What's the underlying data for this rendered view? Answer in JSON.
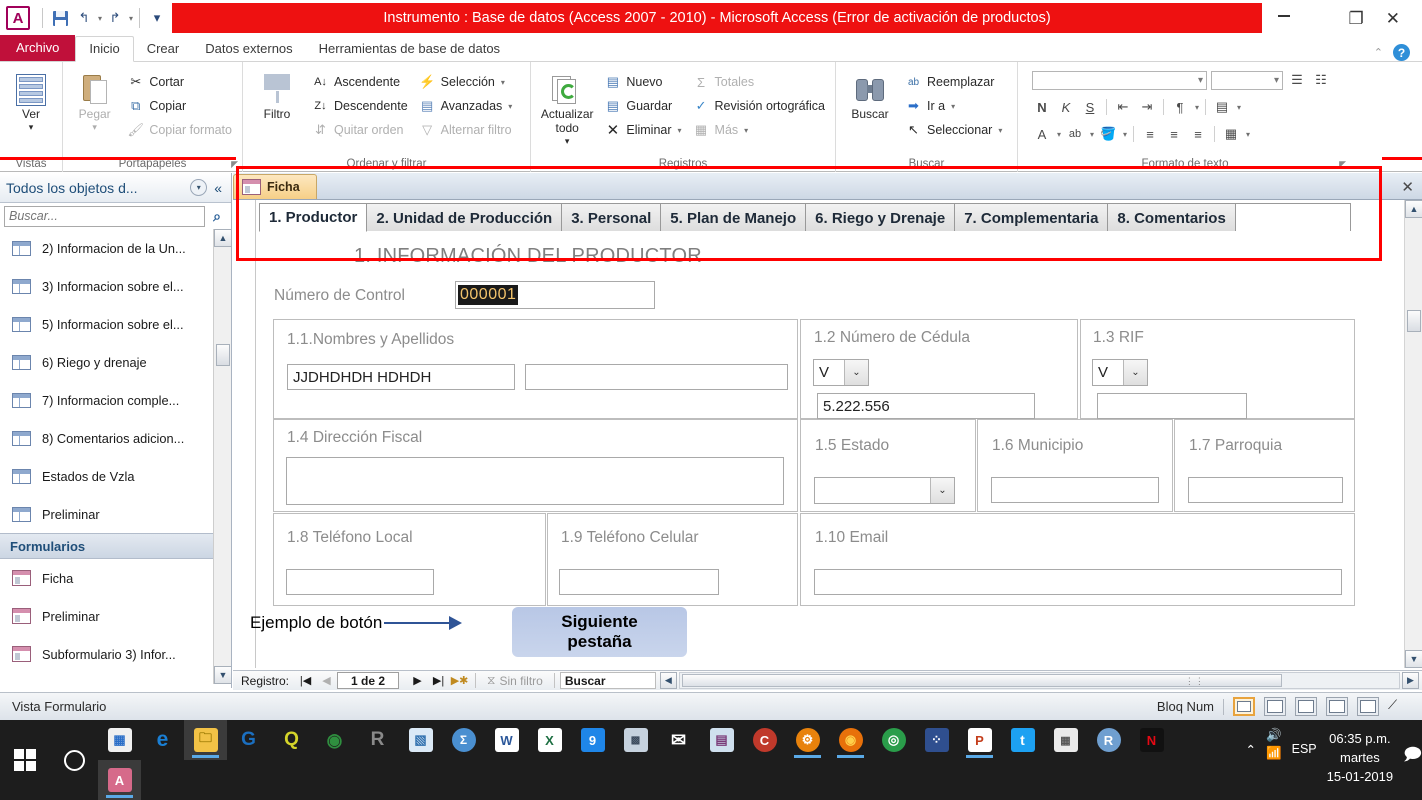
{
  "titlebar": {
    "app_initial": "A",
    "title": "Instrumento : Base de datos (Access 2007 - 2010)  -  Microsoft Access (Error de activación de productos)",
    "qat": [
      {
        "name": "save",
        "glyph": "save"
      },
      {
        "name": "undo",
        "glyph": "↰"
      },
      {
        "name": "redo",
        "glyph": "↱"
      },
      {
        "name": "customize",
        "glyph": "▾"
      }
    ],
    "window_buttons": {
      "minimize": "—",
      "restore": "❐",
      "close": "✕"
    }
  },
  "ribbon_tabs": {
    "file": "Archivo",
    "tabs": [
      "Inicio",
      "Crear",
      "Datos externos",
      "Herramientas de base de datos"
    ],
    "active": "Inicio",
    "collapse_glyph": "⌃",
    "help_glyph": "?"
  },
  "ribbon": {
    "groups": [
      {
        "name": "Vistas",
        "title": "Vistas",
        "big": [
          {
            "label": "Ver",
            "caret": "▾",
            "icon": "view-datasheet-icon"
          }
        ],
        "small": []
      },
      {
        "name": "Portapapeles",
        "title": "Portapapeles",
        "big": [
          {
            "label": "Pegar",
            "caret": "▾",
            "icon": "paste-icon",
            "disabled": true
          }
        ],
        "small": [
          {
            "label": "Cortar",
            "icon": "scissors-icon",
            "glyph": "✂",
            "disabled": false
          },
          {
            "label": "Copiar",
            "icon": "copy-icon",
            "glyph": "⧉",
            "disabled": false
          },
          {
            "label": "Copiar formato",
            "icon": "format-painter-icon",
            "glyph": "🖌",
            "disabled": true
          }
        ],
        "launcher": true
      },
      {
        "name": "Ordenar y filtrar",
        "title": "Ordenar y filtrar",
        "big": [
          {
            "label": "Filtro",
            "caret": "",
            "icon": "funnel-icon"
          }
        ],
        "small": [
          {
            "label": "Ascendente",
            "icon": "sort-ascending-icon",
            "glyph": "A↓",
            "disabled": false
          },
          {
            "label": "Descendente",
            "icon": "sort-descending-icon",
            "glyph": "Z↓",
            "disabled": false
          },
          {
            "label": "Quitar orden",
            "icon": "clear-sort-icon",
            "glyph": "⇵",
            "disabled": true
          },
          {
            "label": "Selección",
            "icon": "selection-icon",
            "glyph": "⚡",
            "caret": "▾",
            "disabled": false
          },
          {
            "label": "Avanzadas",
            "icon": "advanced-filter-icon",
            "glyph": "▤",
            "caret": "▾",
            "disabled": false
          },
          {
            "label": "Alternar filtro",
            "icon": "toggle-filter-icon",
            "glyph": "▽",
            "disabled": true
          }
        ]
      },
      {
        "name": "Registros",
        "title": "Registros",
        "big": [
          {
            "label": "Actualizar todo",
            "caret": "▾",
            "icon": "refresh-all-icon"
          }
        ],
        "small": [
          {
            "label": "Nuevo",
            "icon": "new-record-icon",
            "glyph": "▤",
            "disabled": false
          },
          {
            "label": "Guardar",
            "icon": "save-record-icon",
            "glyph": "▤",
            "disabled": false
          },
          {
            "label": "Eliminar",
            "icon": "delete-record-icon",
            "glyph": "✕",
            "caret": "▾",
            "disabled": false
          },
          {
            "label": "Totales",
            "icon": "totals-icon",
            "glyph": "Σ",
            "disabled": true
          },
          {
            "label": "Revisión ortográfica",
            "icon": "spelling-icon",
            "glyph": "✓",
            "disabled": false
          },
          {
            "label": "Más",
            "icon": "more-icon",
            "glyph": "▦",
            "caret": "▾",
            "disabled": true
          }
        ]
      },
      {
        "name": "Buscar",
        "title": "Buscar",
        "big": [
          {
            "label": "Buscar",
            "caret": "",
            "icon": "binoculars-icon"
          }
        ],
        "small": [
          {
            "label": "Reemplazar",
            "icon": "replace-icon",
            "glyph": "ab",
            "disabled": false
          },
          {
            "label": "Ir a",
            "icon": "goto-icon",
            "glyph": "➡",
            "caret": "▾",
            "disabled": false
          },
          {
            "label": "Seleccionar",
            "icon": "select-icon",
            "glyph": "↖",
            "caret": "▾",
            "disabled": false
          }
        ]
      },
      {
        "name": "Formato de texto",
        "title": "Formato de texto",
        "big": [],
        "small": [],
        "font_controls": {
          "font_name": "",
          "font_size": "",
          "bold": "N",
          "italic": "K",
          "underline": "S",
          "bullets_icon": "bullet-list-icon",
          "numbering_icon": "numbered-list-icon",
          "outdent_icon": "decrease-indent-icon",
          "indent_icon": "increase-indent-icon",
          "ltr_icon": "text-direction-icon",
          "grid_icon": "gridlines-icon",
          "font_color": "A",
          "highlight": "ab",
          "fill_color": "fill-color-icon",
          "align_left_icon": "align-left-icon",
          "align_center_icon": "align-center-icon",
          "align_right_icon": "align-right-icon",
          "alt_fill_icon": "alternate-row-color-icon"
        },
        "launcher": true
      }
    ]
  },
  "navpane": {
    "title": "Todos los objetos d...",
    "dropdown_glyph": "▾",
    "collapse_glyph": "«",
    "search_placeholder": "Buscar...",
    "search_value": "",
    "search_icon": "search-icon",
    "tables": [
      "2) Informacion de la Un...",
      "3) Informacion sobre el...",
      "5) Informacion sobre el...",
      "6) Riego y drenaje",
      "7) Informacion comple...",
      "8) Comentarios adicion...",
      "Estados de Vzla",
      "Preliminar"
    ],
    "group_header": "Formularios",
    "group_chevron": "⌃",
    "forms": [
      "Ficha",
      "Preliminar",
      "Subformulario 3) Infor..."
    ],
    "scroll_up_glyph": "▲",
    "scroll_down_glyph": "▼"
  },
  "document": {
    "tab_label": "Ficha",
    "tab_icon": "form-icon",
    "close_glyph": "✕"
  },
  "form": {
    "tabs": [
      "1. Productor",
      "2. Unidad de Producción",
      "3. Personal",
      "5. Plan de Manejo",
      "6. Riego y Drenaje",
      "7. Complementaria",
      "8. Comentarios"
    ],
    "active_tab": "1. Productor",
    "heading": "1. INFORMACIÓN DEL PRODUCTOR",
    "control_number": {
      "label": "Número de Control",
      "value": "000001",
      "selected": true
    },
    "fields": {
      "names": {
        "label": "1.1.Nombres y Apellidos",
        "value_first": "JJDHDHDH HDHDH",
        "value_second": ""
      },
      "cedula": {
        "label": "1.2 Número de Cédula",
        "prefix": "V",
        "value": "5.222.556"
      },
      "rif": {
        "label": "1.3 RIF",
        "prefix": "V",
        "value": ""
      },
      "direccion": {
        "label": "1.4 Dirección Fiscal",
        "value": ""
      },
      "estado": {
        "label": "1.5 Estado",
        "value": ""
      },
      "municipio": {
        "label": "1.6 Municipio",
        "value": ""
      },
      "parroquia": {
        "label": "1.7 Parroquia",
        "value": ""
      },
      "telefono_local": {
        "label": "1.8 Teléfono Local",
        "value": ""
      },
      "telefono_celular": {
        "label": "1.9 Teléfono Celular",
        "value": ""
      },
      "email": {
        "label": "1.10 Email",
        "value": ""
      }
    },
    "annotation": {
      "label": "Ejemplo de botón",
      "button_line1": "Siguiente",
      "button_line2": "pestaña",
      "arrow_color": "#2f5496"
    }
  },
  "record_nav": {
    "label": "Registro:",
    "first_glyph": "|◀",
    "prev_glyph": "◀",
    "position": "1 de 2",
    "next_glyph": "▶",
    "last_glyph": "▶|",
    "new_glyph": "▶✱",
    "filter_icon": "filter-off-icon",
    "filter_label": "Sin filtro",
    "search_label": "Buscar",
    "hscroll_left_glyph": "◀",
    "hscroll_right_glyph": "▶"
  },
  "statusbar": {
    "left_text": "Vista Formulario",
    "num_lock": "Bloq Num",
    "view_buttons": [
      {
        "name": "form-view",
        "active": true
      },
      {
        "name": "datasheet-view",
        "active": false
      },
      {
        "name": "pivottable-view",
        "active": false
      },
      {
        "name": "pivotchart-view",
        "active": false
      },
      {
        "name": "layout-view",
        "active": false
      },
      {
        "name": "design-view",
        "active": false
      }
    ]
  },
  "taskbar": {
    "start_icon": "windows-start-icon",
    "cortana_icon": "cortana-icon",
    "items": [
      {
        "name": "microsoft-store",
        "glyph": "▦",
        "color": "#f0f0f0",
        "text": "",
        "active": false
      },
      {
        "name": "microsoft-edge",
        "glyph": "e",
        "color": "#1a6fc4",
        "text": "e",
        "active": false
      },
      {
        "name": "file-explorer",
        "glyph": "🗀",
        "color": "#f7c13a",
        "text": "",
        "active": true
      },
      {
        "name": "geogebra",
        "glyph": "G",
        "color": "#1a6fc4",
        "text": "G",
        "active": false
      },
      {
        "name": "qgis",
        "glyph": "Q",
        "color": "#d8d820",
        "text": "Q",
        "active": false
      },
      {
        "name": "arcgis",
        "glyph": "◉",
        "color": "#3a8a3a",
        "text": "",
        "active": false
      },
      {
        "name": "r-console",
        "glyph": "R",
        "color": "#6f6f6f",
        "text": "R",
        "active": false
      },
      {
        "name": "spss-modeler",
        "glyph": "▧",
        "color": "#2f6fae",
        "text": "",
        "active": false
      },
      {
        "name": "spss-statistics",
        "glyph": "Σ",
        "color": "#3f7ebf",
        "text": "Σ",
        "active": false
      },
      {
        "name": "microsoft-word",
        "glyph": "W",
        "color": "#2b579a",
        "text": "W",
        "active": false
      },
      {
        "name": "microsoft-excel",
        "glyph": "X",
        "color": "#1d6f42",
        "text": "X",
        "active": false
      },
      {
        "name": "maps-app",
        "glyph": "9",
        "color": "#1f7fe0",
        "text": "9",
        "active": false
      },
      {
        "name": "stata",
        "glyph": "▩",
        "color": "#8a9bb0",
        "text": "",
        "active": false
      },
      {
        "name": "mail",
        "glyph": "✉",
        "color": "#ffffff",
        "text": "",
        "active": false
      },
      {
        "name": "onenote",
        "glyph": "▤",
        "color": "#80397b",
        "text": "",
        "active": false
      },
      {
        "name": "ccleaner",
        "glyph": "C",
        "color": "#c0392b",
        "text": "C",
        "active": false
      },
      {
        "name": "settings-app",
        "glyph": "⚙",
        "color": "#e8820c",
        "text": "",
        "active": true
      },
      {
        "name": "mozilla-firefox",
        "glyph": "🦊",
        "color": "#e8710a",
        "text": "",
        "active": true
      },
      {
        "name": "google-chrome",
        "glyph": "◎",
        "color": "#2a9d4a",
        "text": "",
        "active": false
      },
      {
        "name": "app-launcher",
        "glyph": "⁘",
        "color": "#3b5fa5",
        "text": "",
        "active": false
      },
      {
        "name": "microsoft-powerpoint",
        "glyph": "P",
        "color": "#c43e1c",
        "text": "P",
        "active": true
      },
      {
        "name": "twitter",
        "glyph": "t",
        "color": "#1da1f2",
        "text": "",
        "active": false
      },
      {
        "name": "calculator",
        "glyph": "▦",
        "color": "#e6e6e6",
        "text": "",
        "active": false
      },
      {
        "name": "rstudio",
        "glyph": "R",
        "color": "#4f7fbf",
        "text": "R",
        "active": false
      },
      {
        "name": "netflix",
        "glyph": "N",
        "color": "#000000",
        "text": "N",
        "active": false
      },
      {
        "name": "microsoft-access",
        "glyph": "A",
        "color": "#a4373a",
        "text": "A",
        "active": true
      }
    ],
    "tray": {
      "chevron": "⌃",
      "volume_icon": "volume-icon",
      "network_icon": "wifi-icon",
      "language": "ESP",
      "time": "06:35 p.m.",
      "day": "martes",
      "date": "15-01-2019",
      "notifications_icon": "notifications-icon"
    }
  }
}
